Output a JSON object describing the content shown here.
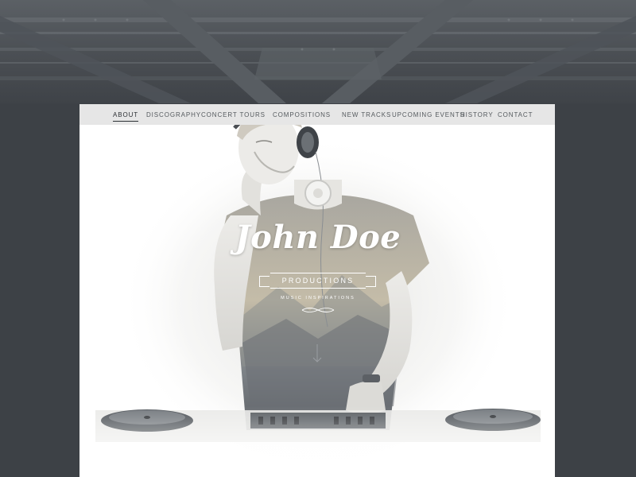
{
  "nav": {
    "items": [
      {
        "label": "ABOUT",
        "active": true
      },
      {
        "label": "DISCOGRAPHY",
        "active": false
      },
      {
        "label": "CONCERT TOURS",
        "active": false
      },
      {
        "label": "COMPOSITIONS",
        "active": false
      },
      {
        "label": "NEW TRACKS",
        "active": false
      },
      {
        "label": "UPCOMING EVENTS",
        "active": false
      },
      {
        "label": "HISTORY",
        "active": false
      },
      {
        "label": "CONTACT",
        "active": false
      }
    ]
  },
  "hero": {
    "logo_script": "John Doe",
    "ribbon_text": "PRODUCTIONS",
    "tagline": "MUSIC INSPIRATIONS"
  },
  "colors": {
    "background": "#3d4146",
    "navbar": "#e6e6e6",
    "nav_text": "#555a5e",
    "nav_active": "#2c3034",
    "page": "#ffffff"
  },
  "icons": {
    "scroll": "down-arrow-icon",
    "flourish": "flourish-ornament-icon"
  }
}
